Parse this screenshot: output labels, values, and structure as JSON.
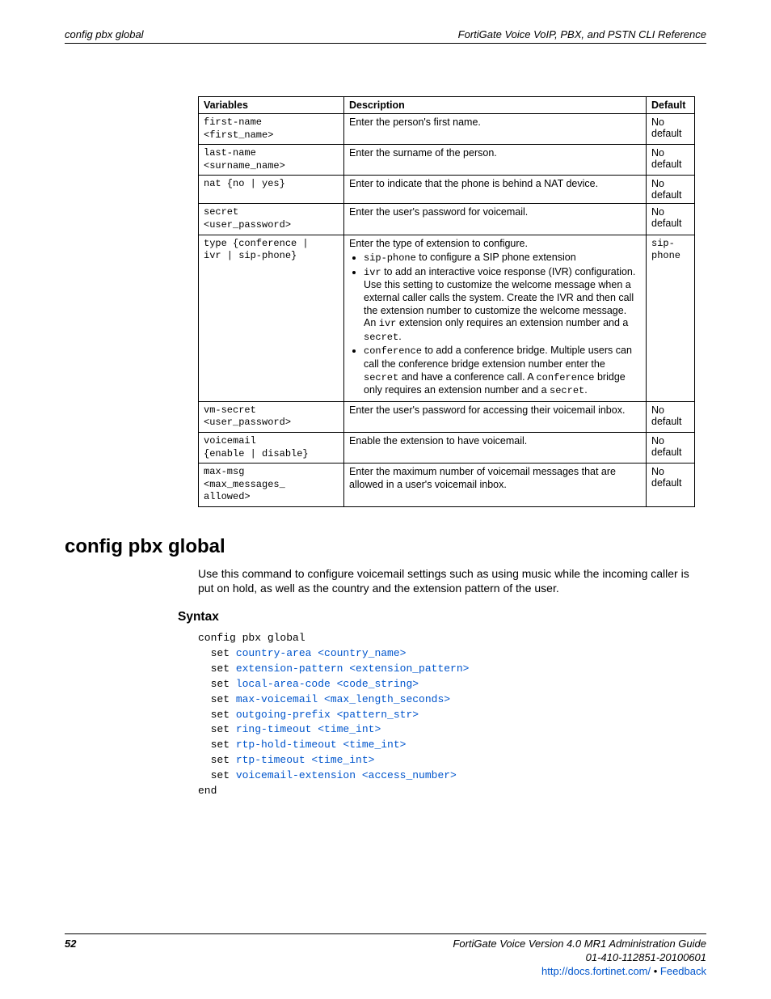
{
  "header": {
    "left": "config pbx global",
    "right": "FortiGate Voice VoIP, PBX, and PSTN CLI Reference"
  },
  "table": {
    "headers": {
      "variables": "Variables",
      "description": "Description",
      "default": "Default"
    },
    "rows": [
      {
        "var_1": "first-name",
        "var_2": "<first_name>",
        "desc_plain": "Enter the person's first name.",
        "default": "No default"
      },
      {
        "var_1": "last-name",
        "var_2": "<surname_name>",
        "desc_plain": "Enter the surname of the person.",
        "default": "No default"
      },
      {
        "var_1": "nat {no | yes}",
        "var_2": "",
        "desc_plain": "Enter to indicate that the phone is behind a NAT device.",
        "default": "No default"
      },
      {
        "var_1": "secret",
        "var_2": "<user_password>",
        "desc_plain": "Enter the user's password for voicemail.",
        "default": "No default"
      },
      {
        "var_1": "type {conference |",
        "var_2": "ivr | sip-phone}",
        "desc_intro": "Enter the type of extension to configure.",
        "b1_code": "sip-phone",
        "b1_rest": " to configure a SIP phone extension",
        "b2_code1": "ivr",
        "b2_mid1": " to add an interactive voice response (IVR) configuration. Use this setting to customize the welcome message when a external caller calls the system. Create the IVR and then call the extension number to customize the welcome message. An ",
        "b2_code2": "ivr",
        "b2_mid2": " extension only requires an extension number and a ",
        "b2_code3": "secret",
        "b2_end": ".",
        "b3_code1": "conference",
        "b3_mid1": " to add a conference bridge. Multiple users can call the conference bridge extension number enter the ",
        "b3_code2": "secret",
        "b3_mid2": " and have a conference call. A ",
        "b3_code3": "conference",
        "b3_mid3": " bridge only requires an extension number and a ",
        "b3_code4": "secret",
        "b3_end": ".",
        "default_1": "sip-",
        "default_2": "phone"
      },
      {
        "var_1": "vm-secret",
        "var_2": "<user_password>",
        "desc_plain": "Enter the user's password for accessing their voicemail inbox.",
        "default": "No default"
      },
      {
        "var_1": "voicemail",
        "var_2": "{enable | disable}",
        "desc_plain": "Enable the extension to have voicemail.",
        "default": "No default"
      },
      {
        "var_1": "max-msg",
        "var_2": "<max_messages_",
        "var_3": "allowed>",
        "desc_plain": "Enter the maximum number of voicemail messages that are allowed in a user's voicemail inbox.",
        "default": "No default"
      }
    ]
  },
  "section": {
    "heading": "config pbx global",
    "intro": "Use this command to configure voicemail settings such as using music while the incoming caller is put on hold, as well as the country and the extension pattern of the user.",
    "syntax_label": "Syntax",
    "syntax_lines": {
      "l0": "config pbx global",
      "l1_set": "  set ",
      "l1_link": "country-area <country_name>",
      "l2_set": "  set ",
      "l2_link": "extension-pattern <extension_pattern>",
      "l3_set": "  set ",
      "l3_link": "local-area-code <code_string>",
      "l4_set": "  set ",
      "l4_link": "max-voicemail <max_length_seconds>",
      "l5_set": "  set ",
      "l5_link": "outgoing-prefix <pattern_str>",
      "l6_set": "  set ",
      "l6_link": "ring-timeout <time_int>",
      "l7_set": "  set ",
      "l7_link": "rtp-hold-timeout <time_int>",
      "l8_set": "  set ",
      "l8_link": "rtp-timeout <time_int>",
      "l9_set": "  set ",
      "l9_link": "voicemail-extension <access_number>",
      "lend": "end"
    }
  },
  "footer": {
    "page": "52",
    "line1": "FortiGate Voice Version 4.0 MR1 Administration Guide",
    "line2": "01-410-112851-20100601",
    "url": "http://docs.fortinet.com/",
    "sep": " • ",
    "feedback": "Feedback"
  }
}
